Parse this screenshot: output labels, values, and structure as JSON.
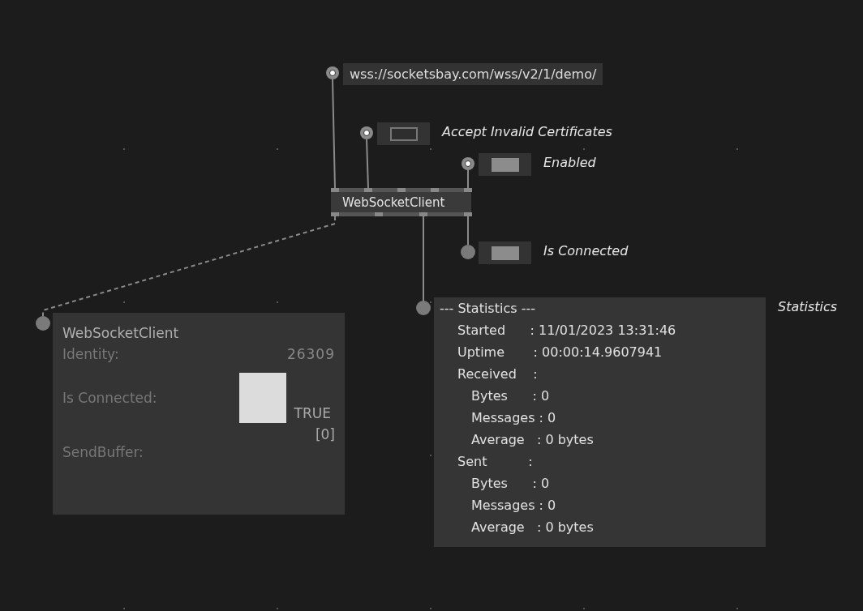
{
  "patch": {
    "url_iobox": {
      "value": "wss://socketsbay.com/wss/v2/1/demo/"
    },
    "toggles": [
      {
        "label": "Accept Invalid Certificates",
        "on": false,
        "kind": "input"
      },
      {
        "label": "Enabled",
        "on": true,
        "kind": "input"
      },
      {
        "label": "Is Connected",
        "on": true,
        "kind": "output"
      }
    ],
    "node": {
      "title": "WebSocketClient"
    },
    "tooltip": {
      "title": "WebSocketClient",
      "rows": [
        {
          "label": "Identity:",
          "kind": "text",
          "value": "26309"
        },
        {
          "label": "Is Connected:",
          "kind": "bool",
          "checked": true,
          "value": "TRUE"
        },
        {
          "label": "SendBuffer:",
          "kind": "list",
          "value": "[0]"
        }
      ]
    },
    "statistics": {
      "label": "Statistics",
      "header": "--- Statistics ---",
      "entries": [
        {
          "text": "Started      : 11/01/2023 13:31:46"
        },
        {
          "text": "Uptime       : 00:00:14.9607941"
        },
        {
          "text": "Received    :",
          "children": [
            {
              "text": "Bytes      : 0"
            },
            {
              "text": "Messages : 0"
            },
            {
              "text": "Average   : 0 bytes"
            }
          ]
        },
        {
          "text": "Sent          :",
          "children": [
            {
              "text": "Bytes      : 0"
            },
            {
              "text": "Messages : 0"
            },
            {
              "text": "Average   : 0 bytes"
            }
          ]
        }
      ]
    }
  }
}
